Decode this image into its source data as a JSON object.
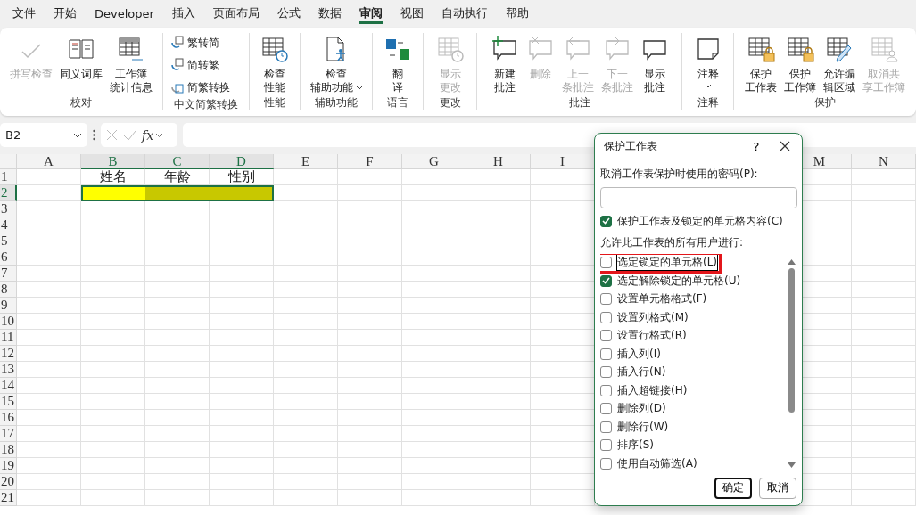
{
  "menu_tabs": [
    {
      "label": "文件",
      "selected": false
    },
    {
      "label": "开始",
      "selected": false
    },
    {
      "label": "Developer",
      "selected": false
    },
    {
      "label": "插入",
      "selected": false
    },
    {
      "label": "页面布局",
      "selected": false
    },
    {
      "label": "公式",
      "selected": false
    },
    {
      "label": "数据",
      "selected": false
    },
    {
      "label": "审阅",
      "selected": true
    },
    {
      "label": "视图",
      "selected": false
    },
    {
      "label": "自动执行",
      "selected": false
    },
    {
      "label": "帮助",
      "selected": false
    }
  ],
  "ribbon": {
    "groups": [
      {
        "label": "校对",
        "items": [
          {
            "kind": "large",
            "label": "拼写检查",
            "disabled": true
          },
          {
            "kind": "large",
            "label": "同义词库",
            "disabled": false
          },
          {
            "kind": "large",
            "label": "工作簿统计信息",
            "disabled": false
          }
        ]
      },
      {
        "label": "中文简繁转换",
        "items": [
          {
            "kind": "small",
            "label": "繁转简",
            "disabled": false
          },
          {
            "kind": "small",
            "label": "简转繁",
            "disabled": false
          },
          {
            "kind": "small",
            "label": "简繁转换",
            "disabled": false
          }
        ]
      },
      {
        "label": "性能",
        "items": [
          {
            "kind": "large",
            "label": "检查性能",
            "disabled": false
          }
        ]
      },
      {
        "label": "辅助功能",
        "items": [
          {
            "kind": "large",
            "label": "检查辅助功能",
            "disabled": false,
            "dropdown": true
          }
        ]
      },
      {
        "label": "语言",
        "items": [
          {
            "kind": "large",
            "label": "翻译",
            "disabled": false
          }
        ]
      },
      {
        "label": "更改",
        "items": [
          {
            "kind": "large",
            "label": "显示更改",
            "disabled": true
          }
        ]
      },
      {
        "label": "批注",
        "items": [
          {
            "kind": "large",
            "label": "新建批注",
            "disabled": false
          },
          {
            "kind": "large",
            "label": "删除",
            "disabled": true
          },
          {
            "kind": "large",
            "label": "上一条批注",
            "disabled": true
          },
          {
            "kind": "large",
            "label": "下一条批注",
            "disabled": true
          },
          {
            "kind": "large",
            "label": "显示批注",
            "disabled": false
          }
        ]
      },
      {
        "label": "注释",
        "items": [
          {
            "kind": "large",
            "label": "注释",
            "disabled": false,
            "dropdown": true
          }
        ]
      },
      {
        "label": "保护",
        "items": [
          {
            "kind": "large",
            "label": "保护工作表",
            "disabled": false
          },
          {
            "kind": "large",
            "label": "保护工作簿",
            "disabled": false
          },
          {
            "kind": "large",
            "label": "允许编辑区域",
            "disabled": false
          },
          {
            "kind": "large",
            "label": "取消共享工作簿",
            "disabled": true
          }
        ]
      }
    ]
  },
  "formula_bar": {
    "name_box": "B2",
    "fx": "fx"
  },
  "sheet": {
    "columns": [
      {
        "label": "A",
        "selected": false
      },
      {
        "label": "B",
        "selected": true
      },
      {
        "label": "C",
        "selected": true
      },
      {
        "label": "D",
        "selected": true
      },
      {
        "label": "E",
        "selected": false
      },
      {
        "label": "F",
        "selected": false
      },
      {
        "label": "G",
        "selected": false
      },
      {
        "label": "H",
        "selected": false
      },
      {
        "label": "I",
        "selected": false
      }
    ],
    "columns_right": [
      {
        "label": "M",
        "selected": false
      },
      {
        "label": "N",
        "selected": false
      }
    ],
    "rows": [
      {
        "number": "1",
        "selected": false,
        "cells": [
          null,
          {
            "text": "姓名",
            "selected": false
          },
          {
            "text": "年龄",
            "selected": false
          },
          {
            "text": "性别",
            "selected": false
          }
        ]
      },
      {
        "number": "2",
        "selected": true,
        "cells": [
          null,
          {
            "color": "#ffff00",
            "selected": true
          },
          {
            "color": "#c8c800",
            "selected": true
          },
          {
            "color": "#c8c800",
            "selected": true
          }
        ]
      },
      {
        "number": "3",
        "selected": false
      },
      {
        "number": "4",
        "selected": false
      },
      {
        "number": "5",
        "selected": false
      },
      {
        "number": "6",
        "selected": false
      },
      {
        "number": "7",
        "selected": false
      },
      {
        "number": "8",
        "selected": false
      },
      {
        "number": "9",
        "selected": false
      },
      {
        "number": "10",
        "selected": false
      },
      {
        "number": "11",
        "selected": false
      },
      {
        "number": "12",
        "selected": false
      },
      {
        "number": "13",
        "selected": false
      },
      {
        "number": "14",
        "selected": false
      },
      {
        "number": "15",
        "selected": false
      },
      {
        "number": "16",
        "selected": false
      },
      {
        "number": "17",
        "selected": false
      },
      {
        "number": "18",
        "selected": false
      },
      {
        "number": "19",
        "selected": false
      },
      {
        "number": "20",
        "selected": false
      },
      {
        "number": "21",
        "selected": false
      }
    ]
  },
  "dialog": {
    "title": "保护工作表",
    "help": "?",
    "password_label": "取消工作表保护时使用的密码(P):",
    "protect_option": {
      "label": "保护工作表及锁定的单元格内容(C)",
      "checked": true
    },
    "allow_label": "允许此工作表的所有用户进行:",
    "permissions": [
      {
        "label": "选定锁定的单元格(L)",
        "checked": false,
        "highlighted": true
      },
      {
        "label": "选定解除锁定的单元格(U)",
        "checked": true,
        "highlighted": false
      },
      {
        "label": "设置单元格格式(F)",
        "checked": false,
        "highlighted": false
      },
      {
        "label": "设置列格式(M)",
        "checked": false,
        "highlighted": false
      },
      {
        "label": "设置行格式(R)",
        "checked": false,
        "highlighted": false
      },
      {
        "label": "插入列(I)",
        "checked": false,
        "highlighted": false
      },
      {
        "label": "插入行(N)",
        "checked": false,
        "highlighted": false
      },
      {
        "label": "插入超链接(H)",
        "checked": false,
        "highlighted": false
      },
      {
        "label": "删除列(D)",
        "checked": false,
        "highlighted": false
      },
      {
        "label": "删除行(W)",
        "checked": false,
        "highlighted": false
      },
      {
        "label": "排序(S)",
        "checked": false,
        "highlighted": false
      },
      {
        "label": "使用自动筛选(A)",
        "checked": false,
        "highlighted": false
      }
    ],
    "buttons": [
      {
        "label": "确定",
        "default": true
      },
      {
        "label": "取消",
        "default": false
      }
    ]
  }
}
